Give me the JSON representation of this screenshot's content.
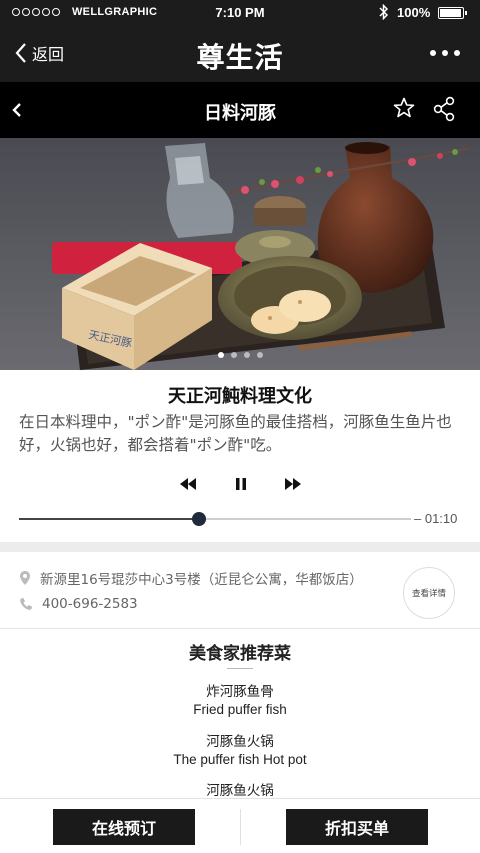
{
  "status_bar": {
    "carrier": "WELLGRAPHIC",
    "time": "7:10 PM",
    "battery": "100%",
    "battery_level": 1.0
  },
  "header": {
    "back_label": "返回",
    "title": "尊生活"
  },
  "sub_header": {
    "title": "日料河豚"
  },
  "carousel": {
    "count": 4,
    "active_index": 0
  },
  "article": {
    "title": "天正河魨料理文化",
    "body": "在日本料理中，\"ポン酢\"是河豚鱼的最佳搭档，河豚鱼生鱼片也好，火锅也好，都会搭着\"ポン酢\"吃。"
  },
  "player": {
    "progress": 0.46,
    "duration": "– 01:10"
  },
  "info": {
    "address": "新源里16号琨莎中心3号楼（近昆仑公寓，华都饭店）",
    "phone": "400-696-2583",
    "details_label": "查看详情"
  },
  "recommendations": {
    "title": "美食家推荐菜",
    "dishes": [
      {
        "cn": "炸河豚鱼骨",
        "en": "Fried puffer fish"
      },
      {
        "cn": "河豚鱼火锅",
        "en": "The puffer fish Hot pot"
      },
      {
        "cn": "河豚鱼火锅",
        "en": ""
      }
    ]
  },
  "bottom_bar": {
    "reserve_label": "在线预订",
    "discount_label": "折扣买单"
  },
  "icons": {
    "back": "chevron-left-icon",
    "more": "more-horizontal-icon",
    "star": "star-outline-icon",
    "share": "share-icon",
    "prev": "rewind-icon",
    "pause": "pause-icon",
    "next": "fast-forward-icon",
    "location": "location-pin-icon",
    "phone": "phone-icon"
  }
}
